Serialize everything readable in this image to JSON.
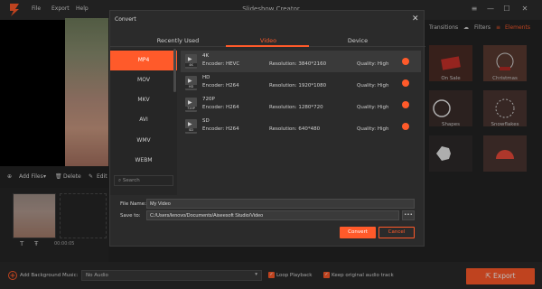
{
  "app": {
    "title": "Slideshow Creator",
    "menu": [
      "File",
      "Export",
      "Help"
    ],
    "window_controls": [
      "≡",
      "—",
      "☐",
      "✕"
    ]
  },
  "toolbar": {
    "add_files": "Add Files",
    "delete": "Delete",
    "edit": "Edit"
  },
  "timeline": {
    "time": "00:00:05"
  },
  "right_panel": {
    "tabs": [
      {
        "label": "Transitions"
      },
      {
        "label": "Filters"
      },
      {
        "label": "Elements"
      }
    ],
    "thumbs": [
      {
        "label": "On Sale"
      },
      {
        "label": "Christmas"
      },
      {
        "label": "Shapes"
      },
      {
        "label": "Snowflakes"
      },
      {
        "label": ""
      },
      {
        "label": ""
      }
    ]
  },
  "bottom": {
    "bg_music_label": "Add Background Music:",
    "audio_value": "No Audio",
    "loop_label": "Loop Playback",
    "keep_audio_label": "Keep original audio track",
    "export_label": "Export"
  },
  "dialog": {
    "title": "Convert",
    "tabs": [
      "Recently Used",
      "Video",
      "Device"
    ],
    "formats": [
      "MP4",
      "MOV",
      "MKV",
      "AVI",
      "WMV",
      "WEBM"
    ],
    "search_placeholder": "Search",
    "options": [
      {
        "name": "4K",
        "tag": "4K",
        "encoder": "Encoder: HEVC",
        "resolution": "Resolution: 3840*2160",
        "quality": "Quality: High"
      },
      {
        "name": "HD",
        "tag": "HD",
        "encoder": "Encoder: H264",
        "resolution": "Resolution: 1920*1080",
        "quality": "Quality: High"
      },
      {
        "name": "720P",
        "tag": "720P",
        "encoder": "Encoder: H264",
        "resolution": "Resolution: 1280*720",
        "quality": "Quality: High"
      },
      {
        "name": "SD",
        "tag": "SD",
        "encoder": "Encoder: H264",
        "resolution": "Resolution: 640*480",
        "quality": "Quality: High"
      }
    ],
    "file_name_label": "File Name:",
    "file_name_value": "My Video",
    "save_to_label": "Save to:",
    "save_to_value": "C:/Users/lenovo/Documents/Aiseesoft Studio/Video",
    "browse_label": "•••",
    "convert_label": "Convert",
    "cancel_label": "Cancel"
  },
  "colors": {
    "accent": "#ff5a2a",
    "background": "#232323"
  }
}
